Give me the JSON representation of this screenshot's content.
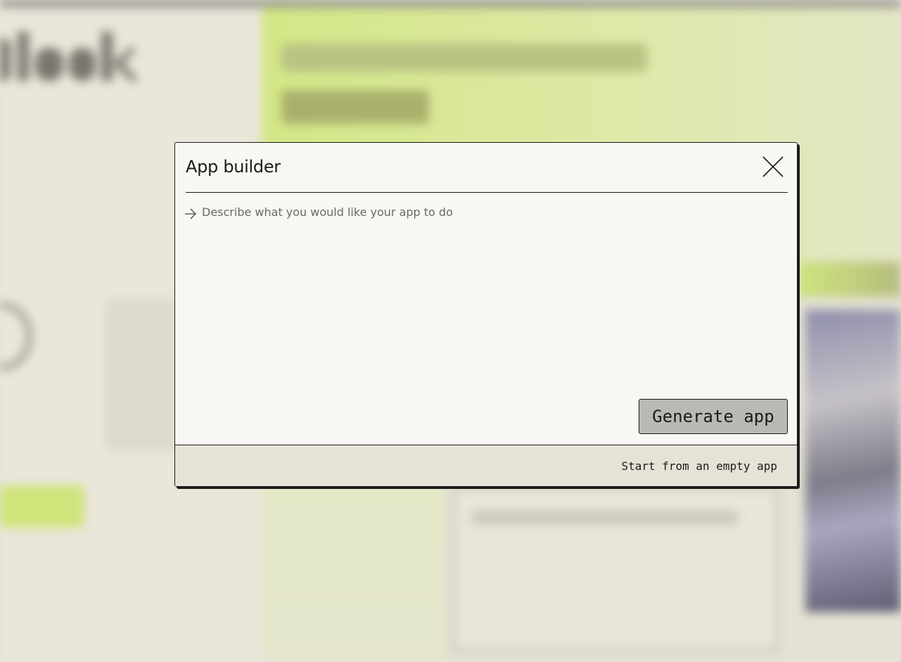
{
  "dialog": {
    "title": "App builder",
    "close_icon": "close-icon",
    "prompt": {
      "icon": "arrow-right-icon",
      "placeholder": "Describe what you would like your app to do",
      "value": ""
    },
    "generate_label": "Generate app",
    "footer_link_label": "Start from an empty app"
  },
  "colors": {
    "dialog_bg": "#f8f7f2",
    "footer_bg": "#e6e2d6",
    "button_bg": "#bab9b6",
    "border": "#1b1b1b",
    "backdrop_accent": "#d3e786"
  }
}
